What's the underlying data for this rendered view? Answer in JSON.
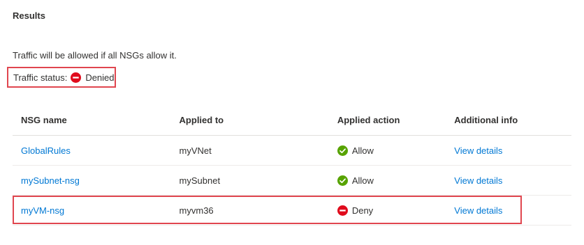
{
  "results": {
    "title": "Results",
    "info_text": "Traffic will be allowed if all NSGs allow it.",
    "traffic_status": {
      "label": "Traffic status:",
      "value": "Denied",
      "icon": "deny-icon"
    }
  },
  "table": {
    "headers": [
      "NSG name",
      "Applied to",
      "Applied action",
      "Additional info"
    ],
    "rows": [
      {
        "nsg_name": "GlobalRules",
        "applied_to": "myVNet",
        "action": "Allow",
        "action_icon": "allow-icon",
        "info": "View details"
      },
      {
        "nsg_name": "mySubnet-nsg",
        "applied_to": "mySubnet",
        "action": "Allow",
        "action_icon": "allow-icon",
        "info": "View details"
      },
      {
        "nsg_name": "myVM-nsg",
        "applied_to": "myvm36",
        "action": "Deny",
        "action_icon": "deny-icon",
        "info": "View details"
      }
    ]
  },
  "colors": {
    "link": "#0078d4",
    "allow": "#57a300",
    "deny": "#e00b1c",
    "highlight": "#e0464f"
  }
}
